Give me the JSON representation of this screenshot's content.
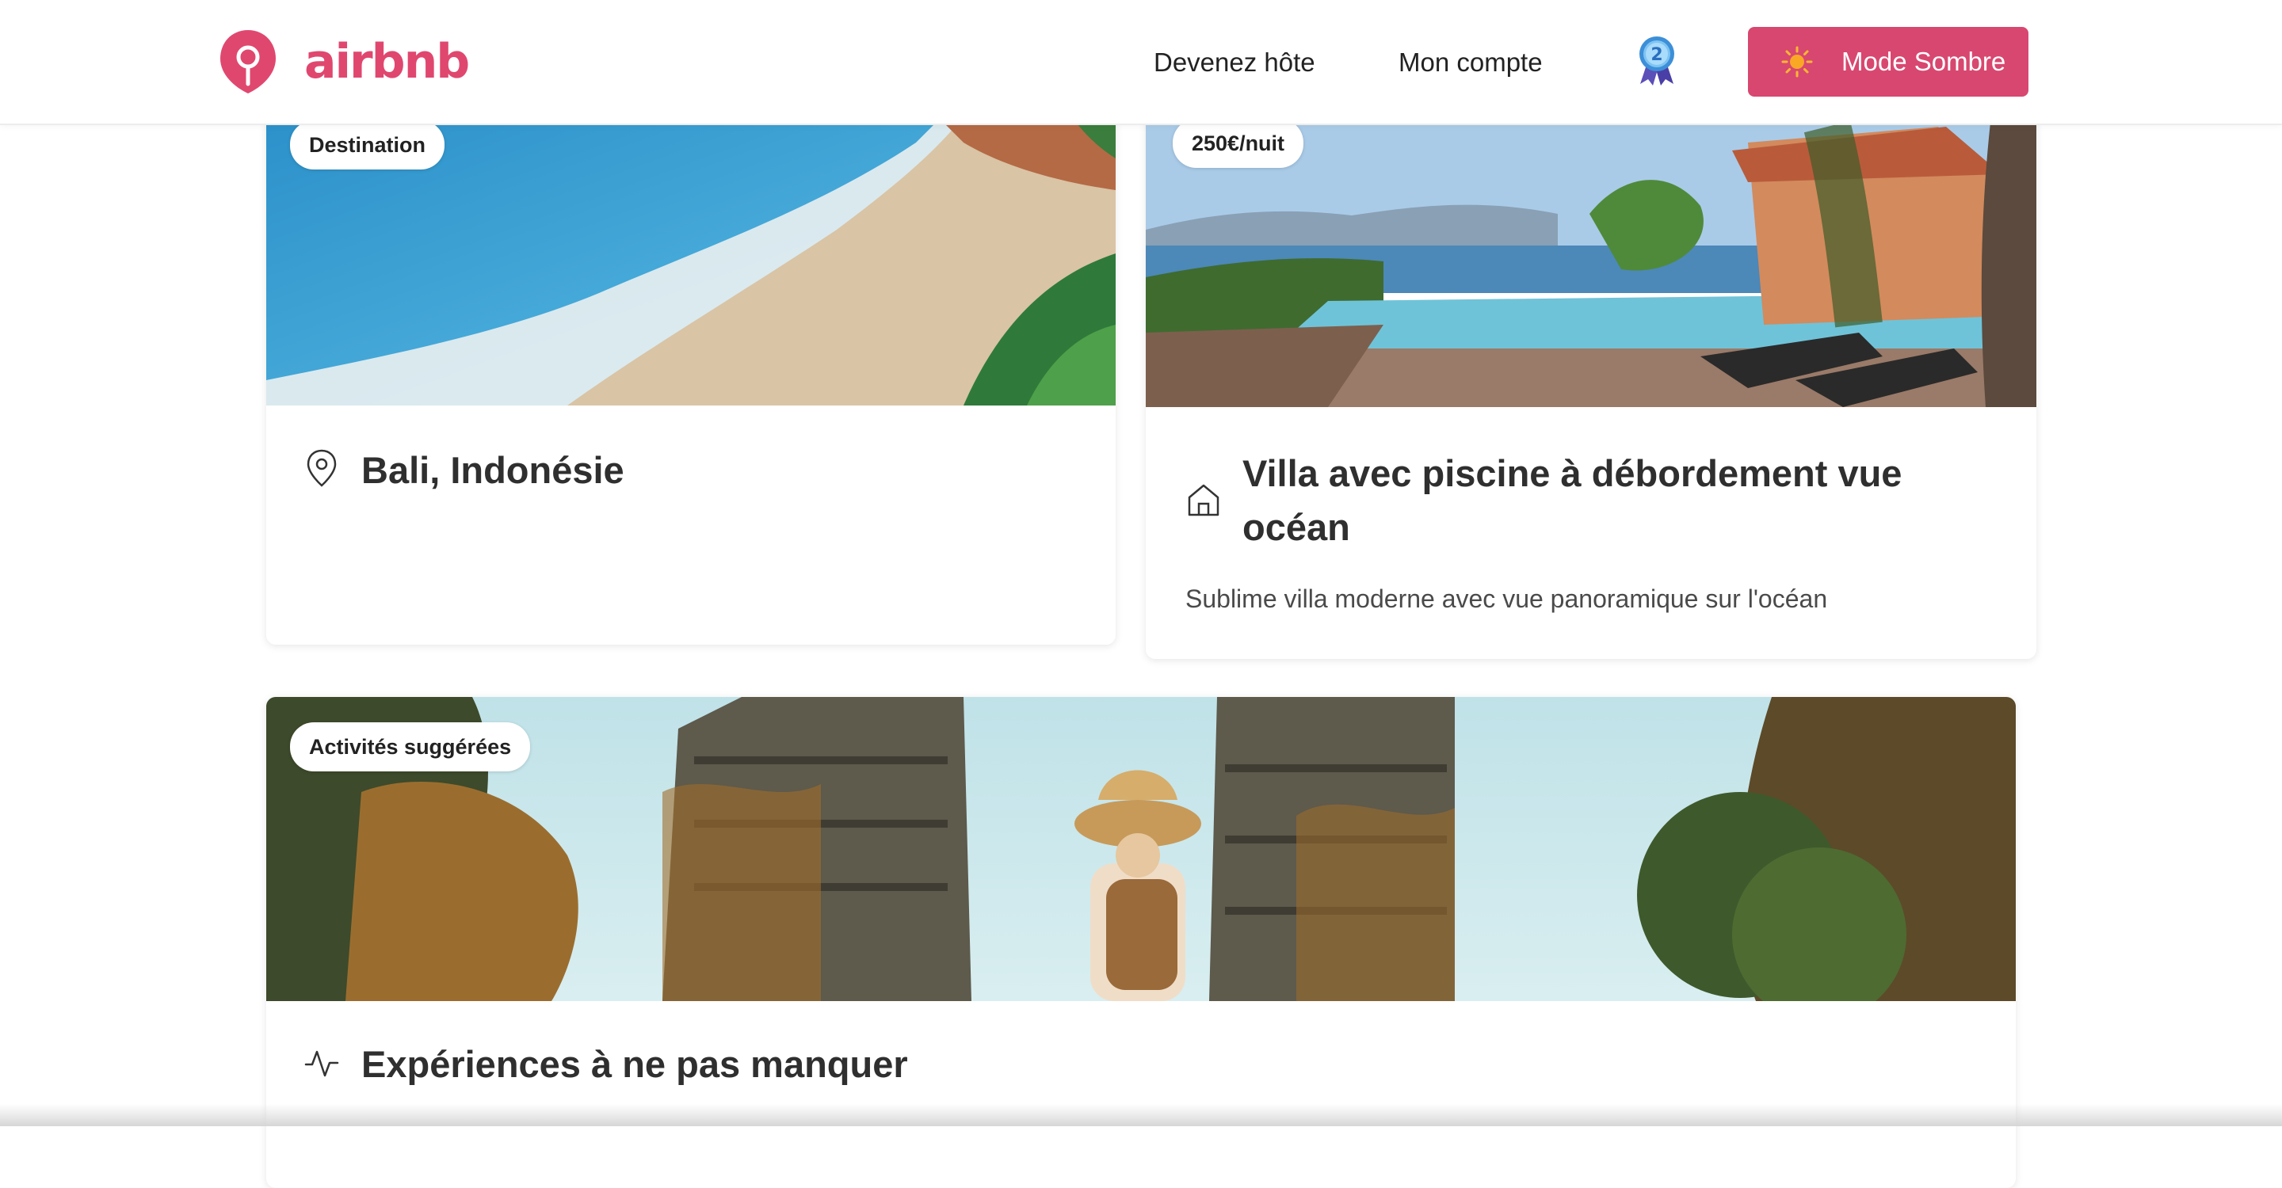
{
  "header": {
    "brand": "airbnb",
    "nav": {
      "host_label": "Devenez hôte",
      "account_label": "Mon compte"
    },
    "level_badge": "2",
    "mode_button_label": "Mode Sombre",
    "colors": {
      "brand": "#e0476f",
      "button": "#d8476f"
    }
  },
  "cards": {
    "destination": {
      "tag": "Destination",
      "icon": "map-pin-icon",
      "title": "Bali, Indonésie"
    },
    "villa": {
      "tag": "250€/nuit",
      "icon": "home-icon",
      "title": "Villa avec piscine à débordement vue océan",
      "description": "Sublime villa moderne avec vue panoramique sur l'océan"
    },
    "activities": {
      "tag": "Activités suggérées",
      "icon": "activity-icon",
      "title": "Expériences à ne pas manquer"
    }
  }
}
